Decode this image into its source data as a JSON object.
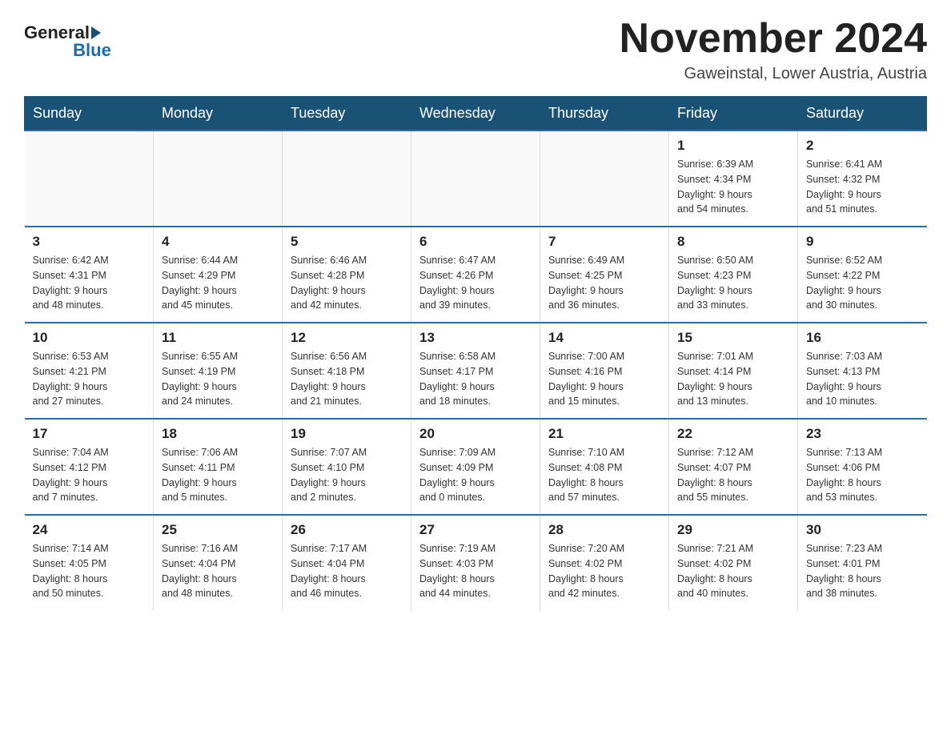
{
  "logo": {
    "general": "General",
    "blue": "Blue"
  },
  "title": "November 2024",
  "subtitle": "Gaweinstal, Lower Austria, Austria",
  "headers": [
    "Sunday",
    "Monday",
    "Tuesday",
    "Wednesday",
    "Thursday",
    "Friday",
    "Saturday"
  ],
  "weeks": [
    [
      {
        "day": "",
        "info": ""
      },
      {
        "day": "",
        "info": ""
      },
      {
        "day": "",
        "info": ""
      },
      {
        "day": "",
        "info": ""
      },
      {
        "day": "",
        "info": ""
      },
      {
        "day": "1",
        "info": "Sunrise: 6:39 AM\nSunset: 4:34 PM\nDaylight: 9 hours\nand 54 minutes."
      },
      {
        "day": "2",
        "info": "Sunrise: 6:41 AM\nSunset: 4:32 PM\nDaylight: 9 hours\nand 51 minutes."
      }
    ],
    [
      {
        "day": "3",
        "info": "Sunrise: 6:42 AM\nSunset: 4:31 PM\nDaylight: 9 hours\nand 48 minutes."
      },
      {
        "day": "4",
        "info": "Sunrise: 6:44 AM\nSunset: 4:29 PM\nDaylight: 9 hours\nand 45 minutes."
      },
      {
        "day": "5",
        "info": "Sunrise: 6:46 AM\nSunset: 4:28 PM\nDaylight: 9 hours\nand 42 minutes."
      },
      {
        "day": "6",
        "info": "Sunrise: 6:47 AM\nSunset: 4:26 PM\nDaylight: 9 hours\nand 39 minutes."
      },
      {
        "day": "7",
        "info": "Sunrise: 6:49 AM\nSunset: 4:25 PM\nDaylight: 9 hours\nand 36 minutes."
      },
      {
        "day": "8",
        "info": "Sunrise: 6:50 AM\nSunset: 4:23 PM\nDaylight: 9 hours\nand 33 minutes."
      },
      {
        "day": "9",
        "info": "Sunrise: 6:52 AM\nSunset: 4:22 PM\nDaylight: 9 hours\nand 30 minutes."
      }
    ],
    [
      {
        "day": "10",
        "info": "Sunrise: 6:53 AM\nSunset: 4:21 PM\nDaylight: 9 hours\nand 27 minutes."
      },
      {
        "day": "11",
        "info": "Sunrise: 6:55 AM\nSunset: 4:19 PM\nDaylight: 9 hours\nand 24 minutes."
      },
      {
        "day": "12",
        "info": "Sunrise: 6:56 AM\nSunset: 4:18 PM\nDaylight: 9 hours\nand 21 minutes."
      },
      {
        "day": "13",
        "info": "Sunrise: 6:58 AM\nSunset: 4:17 PM\nDaylight: 9 hours\nand 18 minutes."
      },
      {
        "day": "14",
        "info": "Sunrise: 7:00 AM\nSunset: 4:16 PM\nDaylight: 9 hours\nand 15 minutes."
      },
      {
        "day": "15",
        "info": "Sunrise: 7:01 AM\nSunset: 4:14 PM\nDaylight: 9 hours\nand 13 minutes."
      },
      {
        "day": "16",
        "info": "Sunrise: 7:03 AM\nSunset: 4:13 PM\nDaylight: 9 hours\nand 10 minutes."
      }
    ],
    [
      {
        "day": "17",
        "info": "Sunrise: 7:04 AM\nSunset: 4:12 PM\nDaylight: 9 hours\nand 7 minutes."
      },
      {
        "day": "18",
        "info": "Sunrise: 7:06 AM\nSunset: 4:11 PM\nDaylight: 9 hours\nand 5 minutes."
      },
      {
        "day": "19",
        "info": "Sunrise: 7:07 AM\nSunset: 4:10 PM\nDaylight: 9 hours\nand 2 minutes."
      },
      {
        "day": "20",
        "info": "Sunrise: 7:09 AM\nSunset: 4:09 PM\nDaylight: 9 hours\nand 0 minutes."
      },
      {
        "day": "21",
        "info": "Sunrise: 7:10 AM\nSunset: 4:08 PM\nDaylight: 8 hours\nand 57 minutes."
      },
      {
        "day": "22",
        "info": "Sunrise: 7:12 AM\nSunset: 4:07 PM\nDaylight: 8 hours\nand 55 minutes."
      },
      {
        "day": "23",
        "info": "Sunrise: 7:13 AM\nSunset: 4:06 PM\nDaylight: 8 hours\nand 53 minutes."
      }
    ],
    [
      {
        "day": "24",
        "info": "Sunrise: 7:14 AM\nSunset: 4:05 PM\nDaylight: 8 hours\nand 50 minutes."
      },
      {
        "day": "25",
        "info": "Sunrise: 7:16 AM\nSunset: 4:04 PM\nDaylight: 8 hours\nand 48 minutes."
      },
      {
        "day": "26",
        "info": "Sunrise: 7:17 AM\nSunset: 4:04 PM\nDaylight: 8 hours\nand 46 minutes."
      },
      {
        "day": "27",
        "info": "Sunrise: 7:19 AM\nSunset: 4:03 PM\nDaylight: 8 hours\nand 44 minutes."
      },
      {
        "day": "28",
        "info": "Sunrise: 7:20 AM\nSunset: 4:02 PM\nDaylight: 8 hours\nand 42 minutes."
      },
      {
        "day": "29",
        "info": "Sunrise: 7:21 AM\nSunset: 4:02 PM\nDaylight: 8 hours\nand 40 minutes."
      },
      {
        "day": "30",
        "info": "Sunrise: 7:23 AM\nSunset: 4:01 PM\nDaylight: 8 hours\nand 38 minutes."
      }
    ]
  ]
}
